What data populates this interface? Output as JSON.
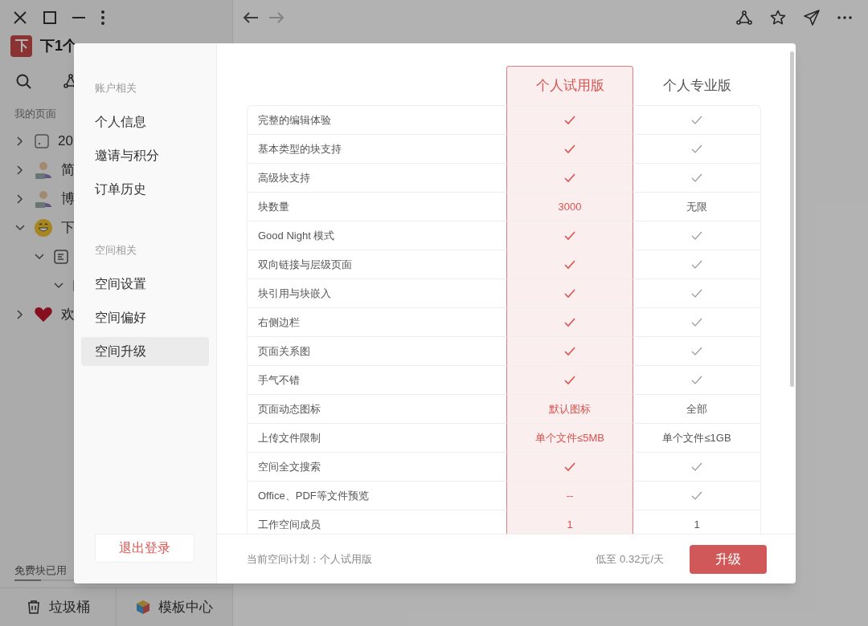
{
  "app": {
    "workspace_title": "下1个",
    "section_label": "我的页面",
    "tree": [
      {
        "label": "20",
        "kind": "page",
        "expanded": false
      },
      {
        "label": "简",
        "kind": "avatar",
        "expanded": false
      },
      {
        "label": "博",
        "kind": "avatar",
        "expanded": false
      },
      {
        "label": "下",
        "kind": "emoji",
        "expanded": true,
        "children": [
          {
            "kind": "doc",
            "expanded": true,
            "children": [
              {
                "kind": "page",
                "expanded": true
              }
            ]
          }
        ]
      },
      {
        "label": "欢",
        "kind": "heart",
        "expanded": false
      }
    ],
    "usage_label": "免费块已用",
    "usage": {
      "level": 0.15
    },
    "bottom_buttons": [
      {
        "label": "垃圾桶",
        "kind": "trash"
      },
      {
        "label": "模板中心",
        "kind": "cube"
      }
    ],
    "nav": {
      "back_disabled": false,
      "forward_disabled": true
    }
  },
  "dialog": {
    "nav_groups": [
      {
        "title": "账户相关",
        "items": [
          {
            "label": "个人信息",
            "selected": false
          },
          {
            "label": "邀请与积分",
            "selected": false
          },
          {
            "label": "订单历史",
            "selected": false
          }
        ]
      },
      {
        "title": "空间相关",
        "items": [
          {
            "label": "空间设置",
            "selected": false
          },
          {
            "label": "空间偏好",
            "selected": false
          },
          {
            "label": "空间升级",
            "selected": true
          }
        ]
      }
    ],
    "logout": "退出登录",
    "plans": [
      {
        "name": "个人试用版",
        "selected": true
      },
      {
        "name": "个人专业版",
        "selected": false
      }
    ],
    "rows": [
      {
        "feature": "完整的编辑体验",
        "cells": [
          {
            "kind": "check"
          },
          {
            "kind": "check"
          }
        ]
      },
      {
        "feature": "基本类型的块支持",
        "cells": [
          {
            "kind": "check"
          },
          {
            "kind": "check"
          }
        ]
      },
      {
        "feature": "高级块支持",
        "cells": [
          {
            "kind": "check"
          },
          {
            "kind": "check"
          }
        ]
      },
      {
        "feature": "块数量",
        "cells": [
          {
            "kind": "text",
            "text": "3000"
          },
          {
            "kind": "text",
            "text": "无限"
          }
        ]
      },
      {
        "feature": "Good Night 模式",
        "cells": [
          {
            "kind": "check"
          },
          {
            "kind": "check"
          }
        ]
      },
      {
        "feature": "双向链接与层级页面",
        "cells": [
          {
            "kind": "check"
          },
          {
            "kind": "check"
          }
        ]
      },
      {
        "feature": "块引用与块嵌入",
        "cells": [
          {
            "kind": "check"
          },
          {
            "kind": "check"
          }
        ]
      },
      {
        "feature": "右侧边栏",
        "cells": [
          {
            "kind": "check"
          },
          {
            "kind": "check"
          }
        ]
      },
      {
        "feature": "页面关系图",
        "cells": [
          {
            "kind": "check"
          },
          {
            "kind": "check"
          }
        ]
      },
      {
        "feature": "手气不错",
        "cells": [
          {
            "kind": "check"
          },
          {
            "kind": "check"
          }
        ]
      },
      {
        "feature": "页面动态图标",
        "cells": [
          {
            "kind": "text",
            "text": "默认图标"
          },
          {
            "kind": "text",
            "text": "全部"
          }
        ]
      },
      {
        "feature": "上传文件限制",
        "cells": [
          {
            "kind": "text",
            "text": "单个文件≤5MB"
          },
          {
            "kind": "text",
            "text": "单个文件≤1GB"
          }
        ]
      },
      {
        "feature": "空间全文搜索",
        "cells": [
          {
            "kind": "check"
          },
          {
            "kind": "check"
          }
        ]
      },
      {
        "feature": "Office、PDF等文件预览",
        "cells": [
          {
            "kind": "text",
            "text": "--"
          },
          {
            "kind": "check"
          }
        ]
      },
      {
        "feature": "工作空间成员",
        "cells": [
          {
            "kind": "text",
            "text": "1"
          },
          {
            "kind": "text",
            "text": "1"
          }
        ]
      }
    ],
    "current_plan": "当前空间计划：个人试用版",
    "price": "低至 0.32元/天",
    "upgrade": "升级"
  }
}
